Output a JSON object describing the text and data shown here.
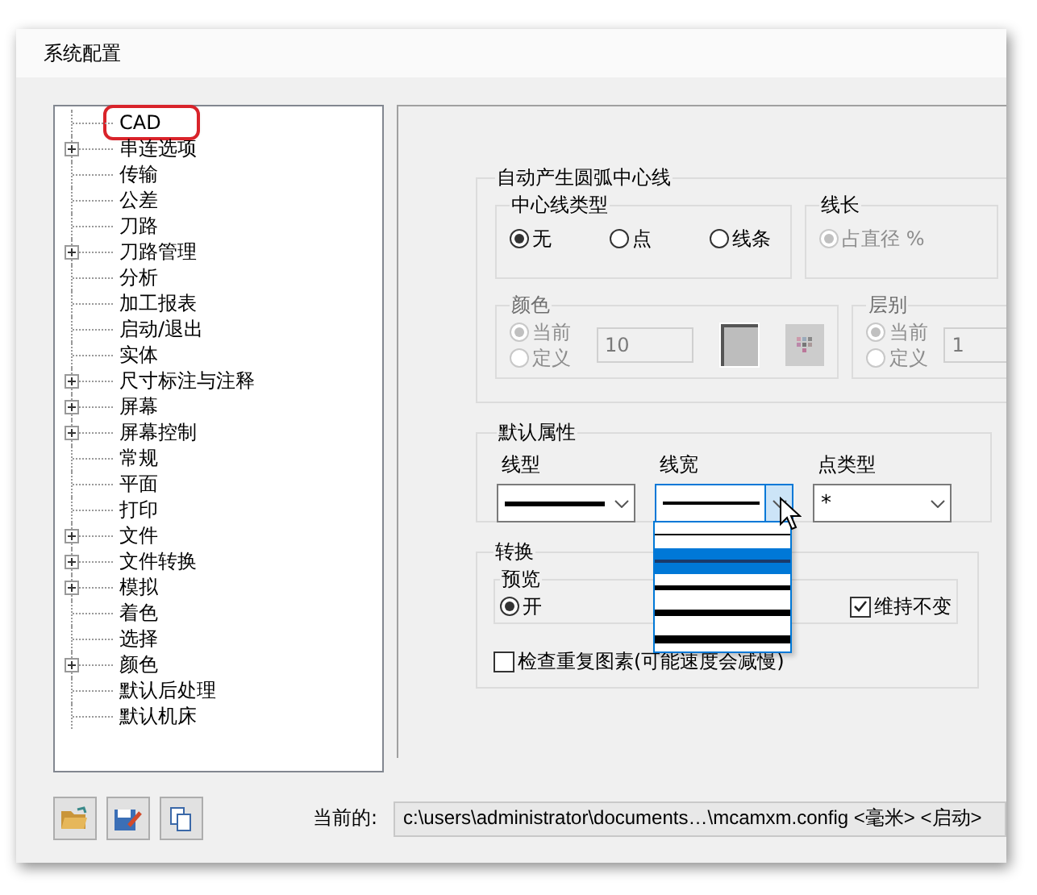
{
  "window": {
    "title": "系统配置"
  },
  "tree": {
    "items": [
      {
        "label": "CAD",
        "selected": true,
        "expandable": false
      },
      {
        "label": "串连选项",
        "selected": false,
        "expandable": true
      },
      {
        "label": "传输",
        "selected": false,
        "expandable": false
      },
      {
        "label": "公差",
        "selected": false,
        "expandable": false
      },
      {
        "label": "刀路",
        "selected": false,
        "expandable": false
      },
      {
        "label": "刀路管理",
        "selected": false,
        "expandable": true
      },
      {
        "label": "分析",
        "selected": false,
        "expandable": false
      },
      {
        "label": "加工报表",
        "selected": false,
        "expandable": false
      },
      {
        "label": "启动/退出",
        "selected": false,
        "expandable": false
      },
      {
        "label": "实体",
        "selected": false,
        "expandable": false
      },
      {
        "label": "尺寸标注与注释",
        "selected": false,
        "expandable": true
      },
      {
        "label": "屏幕",
        "selected": false,
        "expandable": true
      },
      {
        "label": "屏幕控制",
        "selected": false,
        "expandable": true
      },
      {
        "label": "常规",
        "selected": false,
        "expandable": false
      },
      {
        "label": "平面",
        "selected": false,
        "expandable": false
      },
      {
        "label": "打印",
        "selected": false,
        "expandable": false
      },
      {
        "label": "文件",
        "selected": false,
        "expandable": true
      },
      {
        "label": "文件转换",
        "selected": false,
        "expandable": true
      },
      {
        "label": "模拟",
        "selected": false,
        "expandable": true
      },
      {
        "label": "着色",
        "selected": false,
        "expandable": false
      },
      {
        "label": "选择",
        "selected": false,
        "expandable": false
      },
      {
        "label": "颜色",
        "selected": false,
        "expandable": true
      },
      {
        "label": "默认后处理",
        "selected": false,
        "expandable": false
      },
      {
        "label": "默认机床",
        "selected": false,
        "expandable": false
      }
    ]
  },
  "arc_centerlines": {
    "title": "自动产生圆弧中心线",
    "type_group": {
      "title": "中心线类型",
      "options": [
        {
          "label": "无",
          "selected": true
        },
        {
          "label": "点",
          "selected": false
        },
        {
          "label": "线条",
          "selected": false
        }
      ]
    },
    "length_group": {
      "title": "线长",
      "disabled": true,
      "options": [
        {
          "label": "占直径 %",
          "selected": true
        }
      ]
    },
    "color_group": {
      "title": "颜色",
      "disabled": true,
      "value": "10",
      "options": [
        {
          "label": "当前",
          "selected": true
        },
        {
          "label": "定义",
          "selected": false
        }
      ]
    },
    "level_group": {
      "title": "层别",
      "disabled": true,
      "value": "1",
      "options": [
        {
          "label": "当前",
          "selected": true
        },
        {
          "label": "定义",
          "selected": false
        }
      ]
    }
  },
  "defaults": {
    "title": "默认属性",
    "combos": [
      {
        "label": "线型",
        "kind": "line",
        "open": false
      },
      {
        "label": "线宽",
        "kind": "line",
        "open": true,
        "options": [
          {
            "selected": false
          },
          {
            "selected": true
          },
          {
            "selected": false
          },
          {
            "selected": false
          },
          {
            "selected": false
          }
        ]
      },
      {
        "label": "点类型",
        "kind": "text",
        "value": "*",
        "open": false
      }
    ]
  },
  "convert": {
    "title": "转换",
    "preview": {
      "title": "预览",
      "options": [
        {
          "label": "开",
          "selected": true
        }
      ]
    },
    "keep": {
      "label": "维持不变",
      "checked": true
    },
    "check_duplicates": {
      "label": "检查重复图素(可能速度会减慢)",
      "checked": false
    }
  },
  "footer": {
    "current_label": "当前的:",
    "current_value": "c:\\users\\administrator\\documents…\\mcamxm.config <毫米> <启动>"
  }
}
